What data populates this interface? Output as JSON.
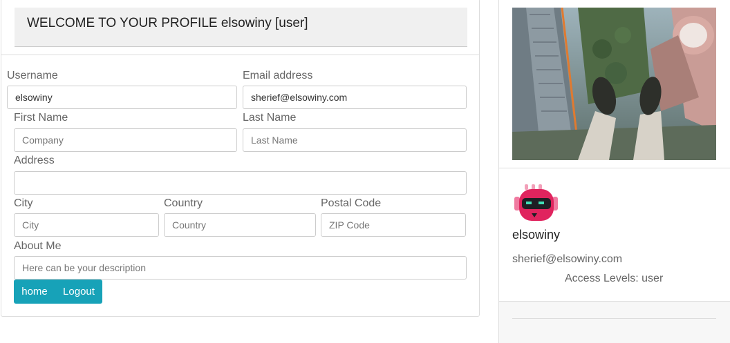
{
  "header": {
    "welcome_text": "WELCOME TO YOUR PROFILE elsowiny [user]"
  },
  "form": {
    "username": {
      "label": "Username",
      "value": "elsowiny"
    },
    "email": {
      "label": "Email address",
      "value": "sherief@elsowiny.com"
    },
    "first_name": {
      "label": "First Name",
      "placeholder": "Company"
    },
    "last_name": {
      "label": "Last Name",
      "placeholder": "Last Name"
    },
    "address": {
      "label": "Address",
      "placeholder": ""
    },
    "city": {
      "label": "City",
      "placeholder": "City"
    },
    "country": {
      "label": "Country",
      "placeholder": "Country"
    },
    "postal_code": {
      "label": "Postal Code",
      "placeholder": "ZIP Code"
    },
    "about_me": {
      "label": "About Me",
      "placeholder": "Here can be your description"
    }
  },
  "buttons": {
    "home_label": "home",
    "logout_label": "Logout"
  },
  "profile_card": {
    "username": "elsowiny",
    "email": "sherief@elsowiny.com",
    "access_levels": "Access Levels: user"
  },
  "colors": {
    "button_bg": "#17a2b8",
    "avatar_pink": "#e0245e"
  }
}
